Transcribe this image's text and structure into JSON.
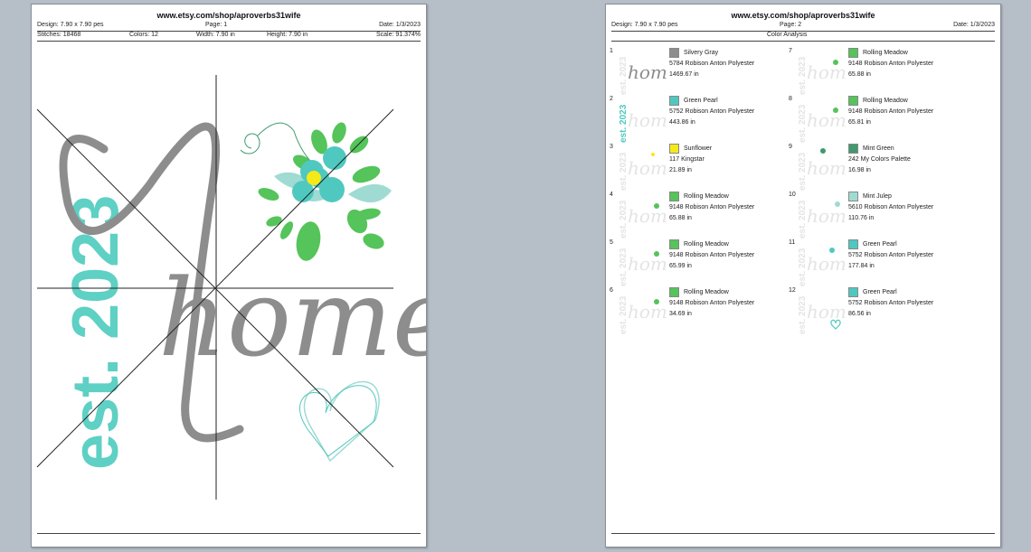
{
  "colors": {
    "silvery_gray": "#8d8d8d",
    "green_pearl": "#4fc9c0",
    "sunflower": "#f5ea17",
    "rolling_meadow": "#55c45a",
    "mint_green": "#3f9a6e",
    "mint_julep": "#9fdbd2"
  },
  "page1": {
    "url": "www.etsy.com/shop/aproverbs31wife",
    "design": "Design: 7.90 x 7.90 pes",
    "page": "Page: 1",
    "date": "Date: 1/3/2023",
    "stitches": "Stitches: 18468",
    "colors_count": "Colors: 12",
    "width": "Width: 7.90 in",
    "height": "Height: 7.90 in",
    "scale": "Scale: 91.374%",
    "art": {
      "word": "home",
      "year": "est. 2023"
    }
  },
  "page2": {
    "url": "www.etsy.com/shop/aproverbs31wife",
    "design": "Design: 7.90 x 7.90 pes",
    "page": "Page: 2",
    "date": "Date: 1/3/2023",
    "section_title": "Color Analysis",
    "entries": [
      {
        "num": "1",
        "name": "Silvery Gray",
        "thread": "5784 Robison Anton Polyester",
        "length": "1469.67 in",
        "color": "#8d8d8d",
        "highlight": "home"
      },
      {
        "num": "2",
        "name": "Green Pearl",
        "thread": "5752 Robison Anton Polyester",
        "length": "443.86 in",
        "color": "#4fc9c0",
        "highlight": "year"
      },
      {
        "num": "3",
        "name": "Sunflower",
        "thread": "117 Kingstar",
        "length": "21.89 in",
        "color": "#f5ea17",
        "highlight": "center"
      },
      {
        "num": "4",
        "name": "Rolling Meadow",
        "thread": "9148 Robison Anton Polyester",
        "length": "65.88 in",
        "color": "#55c45a",
        "highlight": "leaf"
      },
      {
        "num": "5",
        "name": "Rolling Meadow",
        "thread": "9148 Robison Anton Polyester",
        "length": "65.99 in",
        "color": "#55c45a",
        "highlight": "leaf"
      },
      {
        "num": "6",
        "name": "Rolling Meadow",
        "thread": "9148 Robison Anton Polyester",
        "length": "34.69 in",
        "color": "#55c45a",
        "highlight": "leaf"
      },
      {
        "num": "7",
        "name": "Rolling Meadow",
        "thread": "9148 Robison Anton Polyester",
        "length": "65.88 in",
        "color": "#55c45a",
        "highlight": "leaf"
      },
      {
        "num": "8",
        "name": "Rolling Meadow",
        "thread": "9148 Robison Anton Polyester",
        "length": "65.81 in",
        "color": "#55c45a",
        "highlight": "leaf"
      },
      {
        "num": "9",
        "name": "Mint Green",
        "thread": "242 My Colors Palette",
        "length": "16.98 in",
        "color": "#3f9a6e",
        "highlight": "swirl"
      },
      {
        "num": "10",
        "name": "Mint Julep",
        "thread": "5610 Robison Anton Polyester",
        "length": "110.76 in",
        "color": "#9fdbd2",
        "highlight": "petal"
      },
      {
        "num": "11",
        "name": "Green Pearl",
        "thread": "5752 Robison Anton Polyester",
        "length": "177.84 in",
        "color": "#4fc9c0",
        "highlight": "flower"
      },
      {
        "num": "12",
        "name": "Green Pearl",
        "thread": "5752 Robison Anton Polyester",
        "length": "86.56 in",
        "color": "#4fc9c0",
        "highlight": "heart"
      }
    ]
  }
}
